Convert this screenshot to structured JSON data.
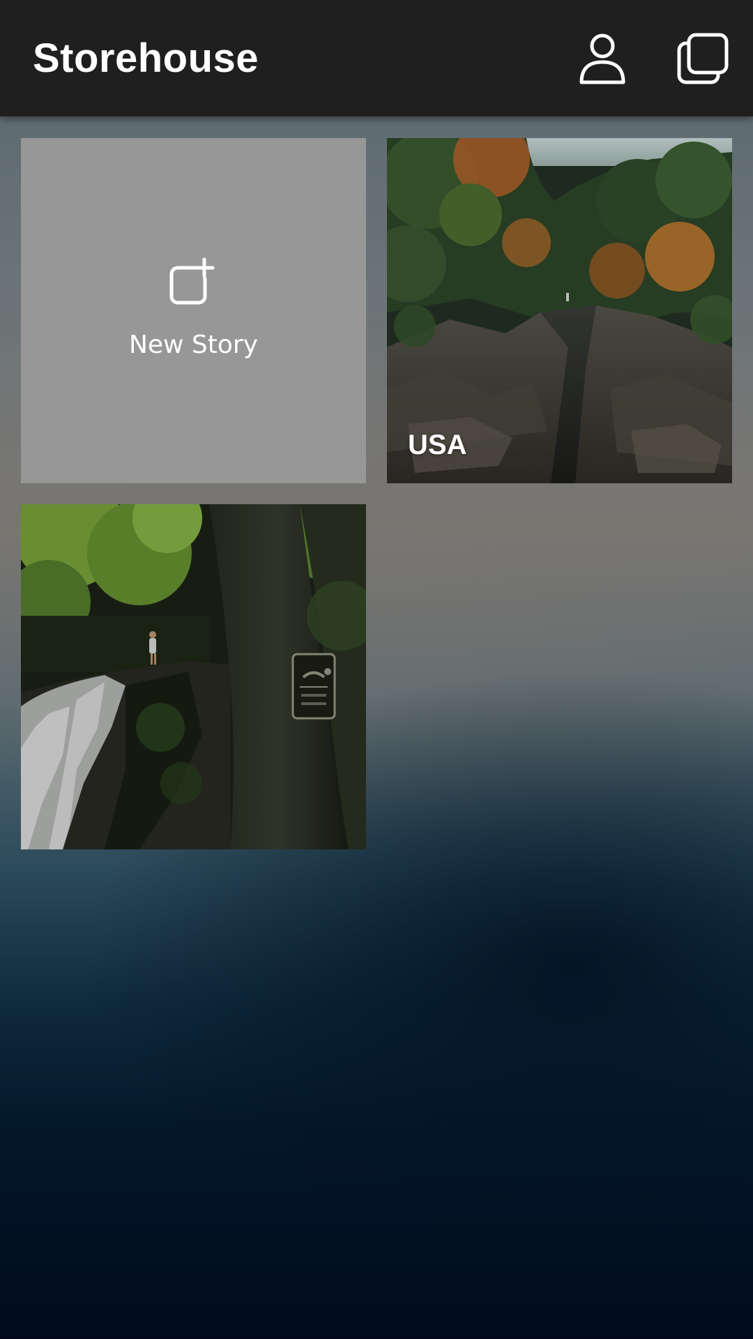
{
  "app_bar": {
    "title": "Storehouse",
    "profile_icon": "person-icon",
    "stories_icon": "stacked-squares-icon"
  },
  "grid": {
    "new_story": {
      "label": "New Story",
      "icon": "add-square-icon"
    },
    "stories": [
      {
        "label": "USA",
        "image": "rocky-gorge-with-autumn-trees"
      },
      {
        "label": "",
        "image": "waterfall-with-person-and-no-swimming-sign"
      }
    ]
  },
  "colors": {
    "app_bar": "#1f1f1f",
    "tile_placeholder": "#979797",
    "text": "#ffffff"
  }
}
